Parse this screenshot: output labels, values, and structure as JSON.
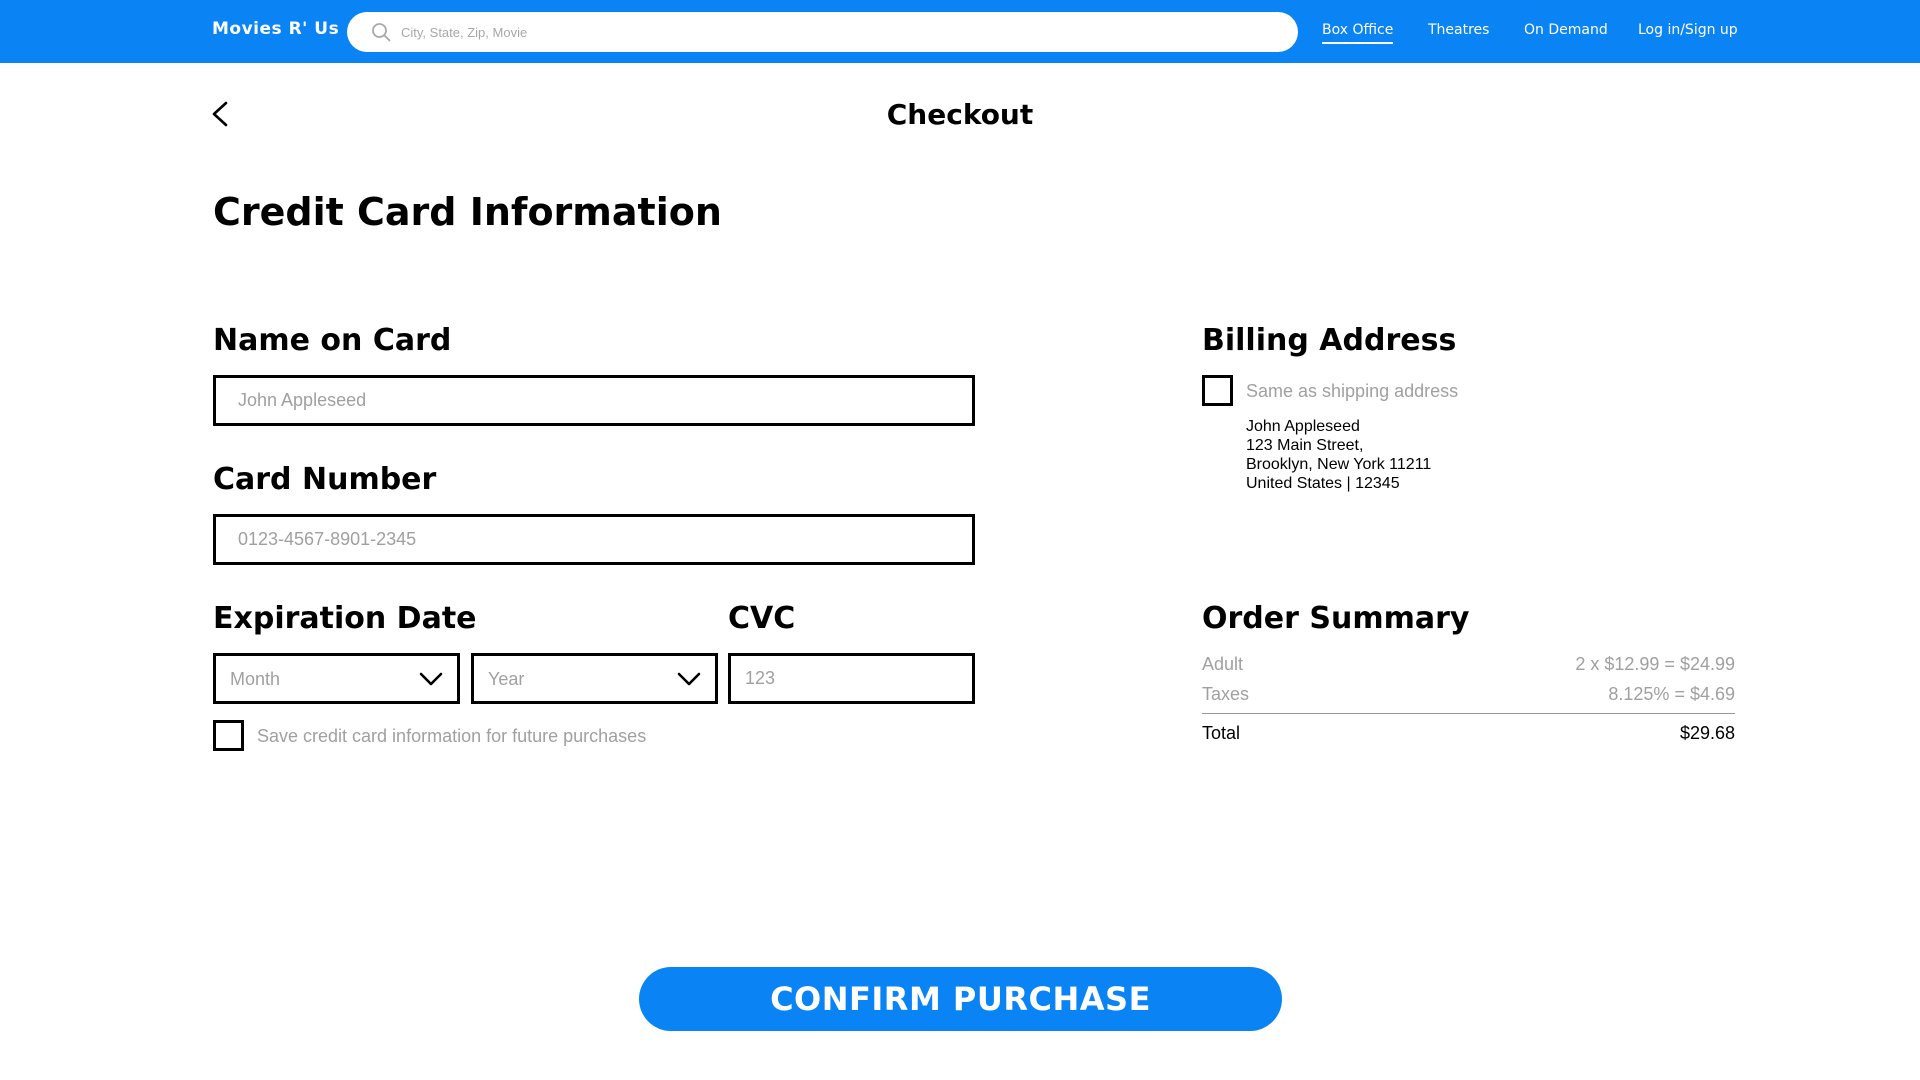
{
  "nav": {
    "brand": "Movies R' Us",
    "search": {
      "placeholder": "City, State, Zip, Movie",
      "value": ""
    },
    "links": [
      {
        "label": "Box Office",
        "active": true
      },
      {
        "label": "Theatres",
        "active": false
      },
      {
        "label": "On Demand",
        "active": false
      },
      {
        "label": "Log in/Sign up",
        "active": false
      }
    ]
  },
  "page": {
    "title": "Checkout",
    "section_title": "Credit Card Information"
  },
  "form": {
    "name_label": "Name on Card",
    "name_placeholder": "John Appleseed",
    "card_label": "Card Number",
    "card_placeholder": "0123-4567-8901-2345",
    "expiration_label": "Expiration Date",
    "month_value": "Month",
    "year_value": "Year",
    "cvc_label": "CVC",
    "cvc_placeholder": "123",
    "save_card_label": "Save credit card information for future purchases",
    "save_card_checked": false
  },
  "billing": {
    "title": "Billing Address",
    "same_as_shipping_label": "Same as shipping address",
    "same_as_shipping_checked": false,
    "address_lines": [
      "John Appleseed",
      "123 Main Street,",
      "Brooklyn, New York 11211",
      "United States | 12345"
    ]
  },
  "summary": {
    "title": "Order Summary",
    "rows": [
      {
        "label": "Adult",
        "value": "2 x $12.99 = $24.99"
      },
      {
        "label": "Taxes",
        "value": "8.125% = $4.69"
      }
    ],
    "total_label": "Total",
    "total_value": "$29.68"
  },
  "confirm_label": "CONFIRM PURCHASE",
  "colors": {
    "accent": "#0a84f5",
    "muted_text": "#a0a0a0"
  }
}
